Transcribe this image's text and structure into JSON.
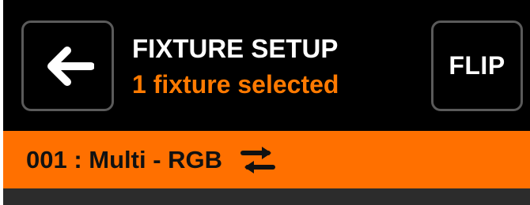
{
  "header": {
    "title": "FIXTURE SETUP",
    "subtitle": "1 fixture selected",
    "back_icon": "arrow-left-icon",
    "flip_label": "FLIP"
  },
  "fixture_bar": {
    "label": "001 : Multi - RGB",
    "swap_icon": "swap-arrows-icon"
  },
  "colors": {
    "header_bg": "#000000",
    "accent": "#ff7000",
    "subtitle": "#ff7a00",
    "button_border": "#5a5a5a",
    "bottom_strip": "#2c2c2c"
  }
}
